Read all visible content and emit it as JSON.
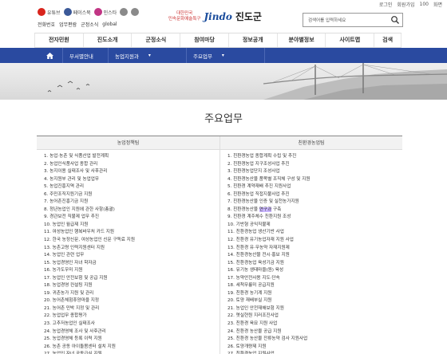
{
  "util": {
    "login": "로그인",
    "join": "회원가입",
    "zoom_value": "100",
    "text_size_label": "글자",
    "reset": "화면"
  },
  "social": [
    {
      "label": "유튜브",
      "color": "#d9241c",
      "icon": "youtube-icon"
    },
    {
      "label": "페이스북",
      "color": "#3b5998",
      "icon": "facebook-icon"
    },
    {
      "label": "인스타",
      "color": "#c13584",
      "icon": "instagram-icon"
    },
    {
      "label": "",
      "color": "#8a8a8a",
      "icon": "blog-icon"
    },
    {
      "label": "",
      "color": "#8a8a8a",
      "icon": "band-icon"
    }
  ],
  "sublinks": [
    "전화번호",
    "업무편람",
    "군정소식",
    "global"
  ],
  "logo": {
    "line1": "대한민국",
    "line2": "민속문화예술특구",
    "brand": "Jindo",
    "name": "진도군"
  },
  "search": {
    "placeholder": "검색어를 입력하세요"
  },
  "gnb": [
    "전자민원",
    "진도소개",
    "군정소식",
    "참여마당",
    "정보공개",
    "분야별정보",
    "사이트맵",
    "검색"
  ],
  "location": {
    "l1": "부서별안내",
    "l2": "농업지원과",
    "l3": "주요업무"
  },
  "page_title": "주요업무",
  "table": {
    "left_header": "농업정책팀",
    "right_header": "친환경농업팀",
    "left_items": [
      "1. 농업·농촌 및 식품산업 발전계획",
      "2. 농업인식품사업 종합 관리",
      "3. 농지이용 실태조사 및 사후관리",
      "4. 농지원부 관리 및 농업업무",
      "5. 농업진흥지역 관리",
      "6. 주민조직지원기금 지원",
      "7. 농어촌진흥기금 지원",
      "8. 청년농업인 지원에 관한 사항(총괄)",
      "9. 경관보전 직불제 업무 추진",
      "10. 농업인 월급제 지원",
      "11. 여성농업인 행복바우처 카드 지원",
      "12. 한국 농정신문, 여성농업인 신문 구독료 지원",
      "13. 농촌고령 인력지원센터 지원",
      "14. 농업인 관련 업무",
      "15. 농업경영인 자녀 학자금",
      "16. 농가도우미 지원",
      "17. 농업인 안전보험 및 공급 지원",
      "18. 농업경영 컨설팅 지원",
      "19. 귀촌농가 지원 및 관리",
      "20. 농어촌체험휴양마을 지정",
      "21. 농어촌 민박 지정 및 관리",
      "22. 농업업무 종합평가",
      "23. 고추저농업인 실태조사",
      "24. 농업경영체 조사 및 사후관리",
      "25. 농업경영체 등록 이력 지원",
      "26. 농촌 공동 아이돌봄센터 설치 지원",
      "27. 농업인 자녀 공동급식 지원",
      "28. 국내외 농업 선진 견학"
    ],
    "right_items": [
      "1. 친환경농업 종합계획 수립 및 추진",
      "2. 친환경농업 지구조성사업 추진",
      "3. 친환경농업단지 조성사업",
      "4. 친환경농산물 품목별 조직체 구성 및 지원",
      "5. 친환경 계약재배 추진 지원사업",
      "6. 친환경농업 직접지불사업 추진",
      "7. 친환경농산물 인증 및 실천농가지원",
      "8. 친환경농산물 연구과 구축",
      "9. 친환경 계주체수 친환지원 조성",
      "10. 기반형 공익직불제",
      "11. 친환경농업 생산기반 사업",
      "12. 친환경 유기농업자재 지원 사업",
      "13. 친환경 유·무농약 자재지원제",
      "14. 친환경농산물 전시·홍보 지원",
      "15. 친환경농업 육성기금 지원",
      "16. 유기농 생태마을(원) 육성",
      "17. 농약안전사용 지도·단속",
      "18. 세척무릎미 공급지원",
      "19. 친환경 농기계 지원",
      "20. 토양 재배부실 지원",
      "21. 농업인 안전재해보험 지원",
      "22. 옛실현원 지러조진사업",
      "23. 친환경 육묘 지원 사업",
      "24. 친환경 농산물 공급 지원",
      "25. 친환경 농산물 잔류농약 검사 지원사업",
      "26. 토양개량제 지원",
      "27. 친환경농업 지원사업",
      "28. 비료생산성 등록 및 관리(비료수급조정)"
    ],
    "highlight": {
      "row": 7,
      "text": "연구과"
    }
  }
}
